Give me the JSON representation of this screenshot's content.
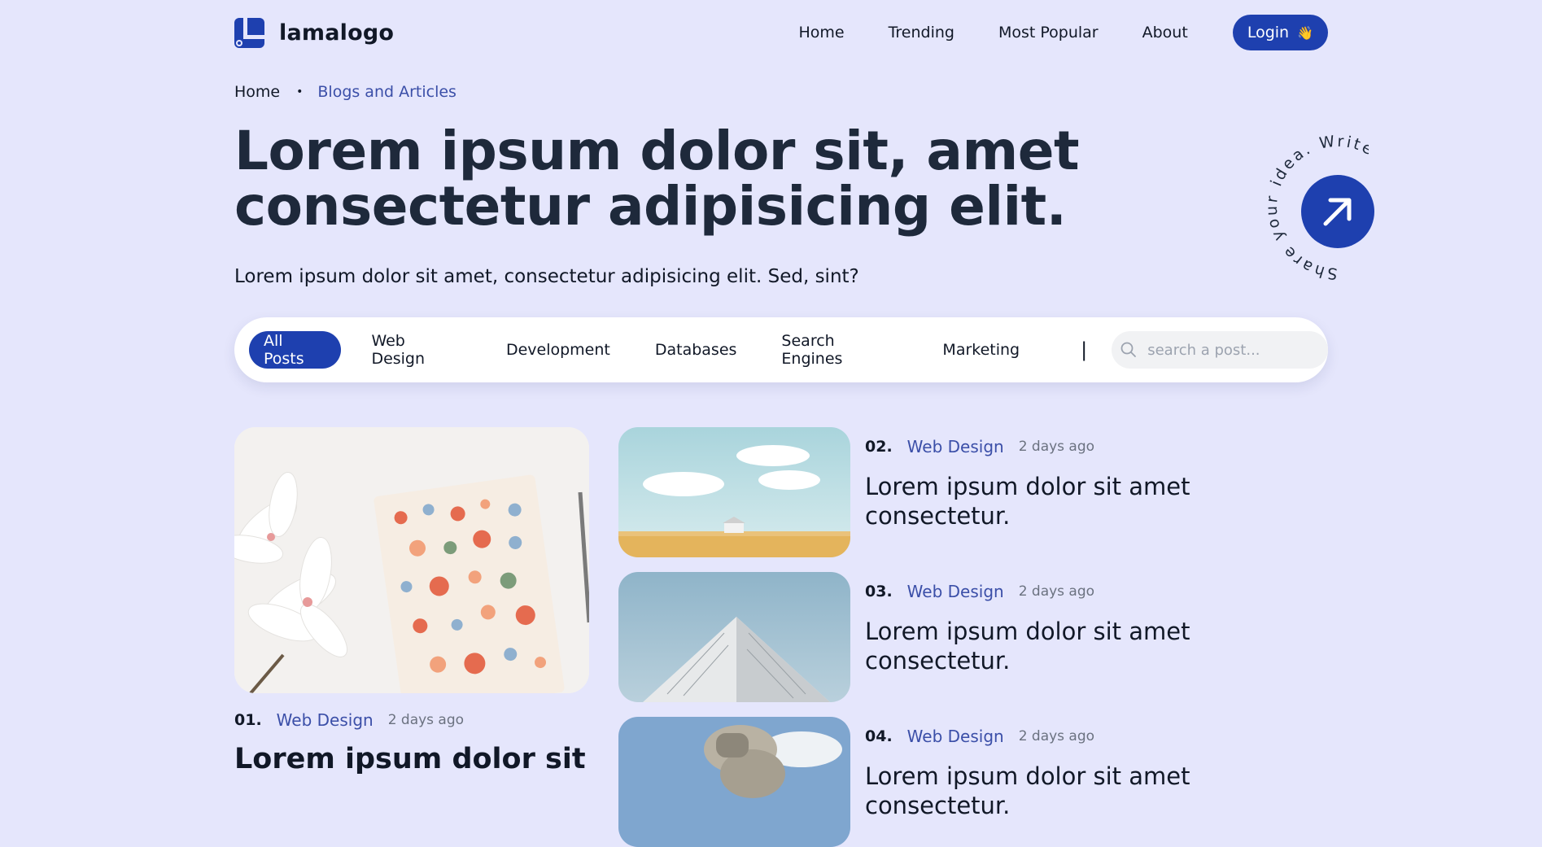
{
  "header": {
    "logo_text": "lamalogo",
    "nav": [
      "Home",
      "Trending",
      "Most Popular",
      "About"
    ],
    "login_label": "Login",
    "login_emoji": "👋"
  },
  "breadcrumb": {
    "home": "Home",
    "separator": "•",
    "current": "Blogs and Articles"
  },
  "hero": {
    "title": "Lorem ipsum dolor sit, amet consectetur adipisicing elit.",
    "subtitle": "Lorem ipsum dolor sit amet, consectetur adipisicing elit. Sed, sint?",
    "share_circle_text": "Share your idea. Write your story.",
    "share_icon": "arrow-up-right-icon"
  },
  "filters": {
    "chips": [
      "All Posts",
      "Web Design",
      "Development",
      "Databases",
      "Search Engines",
      "Marketing"
    ],
    "active": "All Posts",
    "separator": "|",
    "search_placeholder": "search a post...",
    "search_icon": "search-icon"
  },
  "posts": [
    {
      "num": "01.",
      "category": "Web Design",
      "time": "2 days ago",
      "title": "Lorem ipsum dolor sit"
    },
    {
      "num": "02.",
      "category": "Web Design",
      "time": "2 days ago",
      "title": "Lorem ipsum dolor sit amet consectetur."
    },
    {
      "num": "03.",
      "category": "Web Design",
      "time": "2 days ago",
      "title": "Lorem ipsum dolor sit amet consectetur."
    },
    {
      "num": "04.",
      "category": "Web Design",
      "time": "2 days ago",
      "title": "Lorem ipsum dolor sit amet consectetur."
    }
  ],
  "colors": {
    "background": "#e5e6fc",
    "accent": "#1e40af",
    "link": "#3b4fa8",
    "text": "#1e293b"
  }
}
